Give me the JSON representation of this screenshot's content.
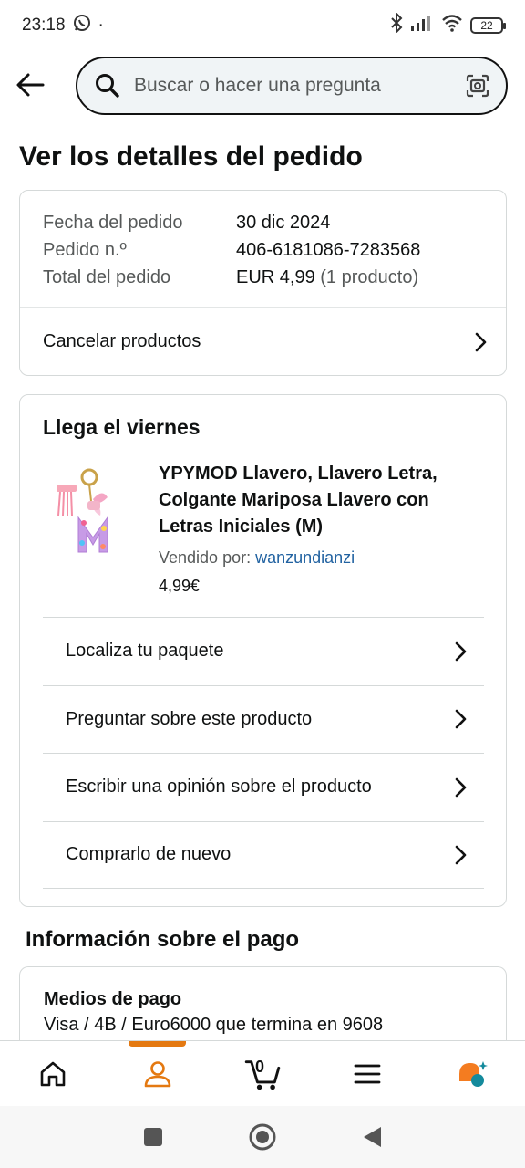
{
  "status_bar": {
    "time": "23:18",
    "dot": "·",
    "battery": "22"
  },
  "header": {
    "search_placeholder": "Buscar o hacer una pregunta"
  },
  "page_title": "Ver los detalles del pedido",
  "order_summary": {
    "rows": [
      {
        "label": "Fecha del pedido",
        "value": "30 dic 2024",
        "extra": ""
      },
      {
        "label": "Pedido n.º",
        "value": "406-6181086-7283568",
        "extra": ""
      },
      {
        "label": "Total del pedido",
        "value": "EUR 4,99",
        "extra": " (1 producto)"
      }
    ],
    "cancel_label": "Cancelar productos"
  },
  "delivery": {
    "title": "Llega el viernes",
    "product": {
      "name": "YPYMOD Llavero, Llavero Letra, Colgante Mariposa Llavero con Letras Iniciales (M)",
      "seller_label": "Vendido por: ",
      "seller_name": "wanzundianzi",
      "price": "4,99€",
      "image_letter": "M"
    },
    "actions": [
      {
        "label": "Localiza tu paquete"
      },
      {
        "label": "Preguntar sobre este producto"
      },
      {
        "label": "Escribir una opinión sobre el producto"
      },
      {
        "label": "Comprarlo de nuevo"
      }
    ]
  },
  "payment": {
    "title": "Información sobre el pago",
    "method_label": "Medios de pago",
    "method_value": "Visa / 4B / Euro6000  que termina en 9608"
  },
  "bottom_nav": {
    "cart_count": "0",
    "active": "account"
  },
  "colors": {
    "accent": "#e47911",
    "link": "#2162a1",
    "text": "#0f1111",
    "muted": "#565959",
    "border": "#d5d9d9",
    "search_bg": "#f0f4f6"
  }
}
